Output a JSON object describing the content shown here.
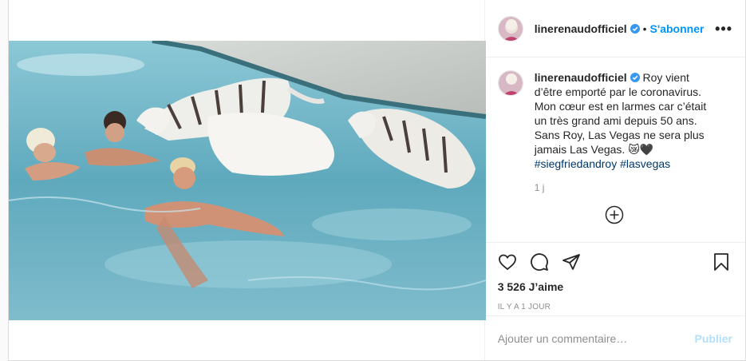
{
  "post": {
    "username": "linerenaudofficiel",
    "follow_label": "S'abonner",
    "dot": "•",
    "more_label": "•••",
    "caption": {
      "text": "Roy vient d’être emporté par le coronavirus. Mon cœur est en larmes car c’était un très grand ami depuis 50 ans. Sans Roy, Las Vegas ne sera plus jamais Las Vegas.",
      "emoji": "😿🖤",
      "hashtags": [
        "#siegfriedandroy",
        "#lasvegas"
      ]
    },
    "caption_age": "1 j",
    "likes": "3 526 J’aime",
    "age": "IL Y A 1 JOUR",
    "comment_placeholder": "Ajouter un commentaire…",
    "publish_label": "Publier"
  },
  "colors": {
    "accent": "#0095f6",
    "publish_disabled": "#b2dffc",
    "muted": "#8e8e8e",
    "pool": "#6fb6c9"
  },
  "icons": [
    "verified-badge-icon",
    "heart-icon",
    "comment-icon",
    "share-icon",
    "bookmark-icon",
    "plus-circle-icon",
    "more-icon"
  ]
}
